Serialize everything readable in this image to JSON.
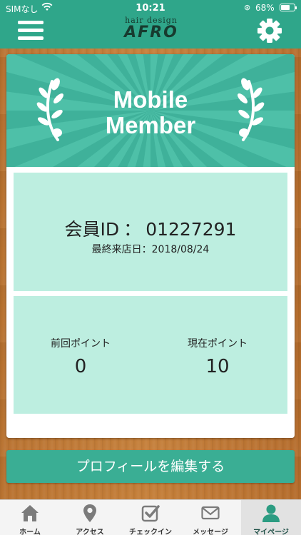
{
  "status_bar": {
    "carrier": "SIMなし",
    "time": "10:21",
    "battery": "68%",
    "battery_level": 0.68
  },
  "header": {
    "logo_small": "hair design",
    "logo_big": "AFRO",
    "menu_icon": "hamburger-menu-icon",
    "settings_icon": "gear-icon"
  },
  "banner": {
    "title_line1": "Mobile",
    "title_line2": "Member"
  },
  "member": {
    "id_label": "会員ID",
    "id_sep": "：",
    "id_value": "01227291",
    "last_visit_label": "最終来店日：",
    "last_visit_value": "2018/08/24"
  },
  "points": {
    "previous_label": "前回ポイント",
    "previous_value": "0",
    "current_label": "現在ポイント",
    "current_value": "10"
  },
  "edit_button": "プロフィールを編集する",
  "tabs": [
    {
      "label": "ホーム",
      "icon": "home-icon"
    },
    {
      "label": "アクセス",
      "icon": "map-pin-icon"
    },
    {
      "label": "チェックイン",
      "icon": "checkin-icon"
    },
    {
      "label": "メッセージ",
      "icon": "mail-icon"
    },
    {
      "label": "マイページ",
      "icon": "user-icon",
      "active": true
    }
  ],
  "colors": {
    "primary": "#2fa68a",
    "banner": "#3fb19a",
    "panel": "#bdeee0",
    "button": "#3aae94"
  }
}
